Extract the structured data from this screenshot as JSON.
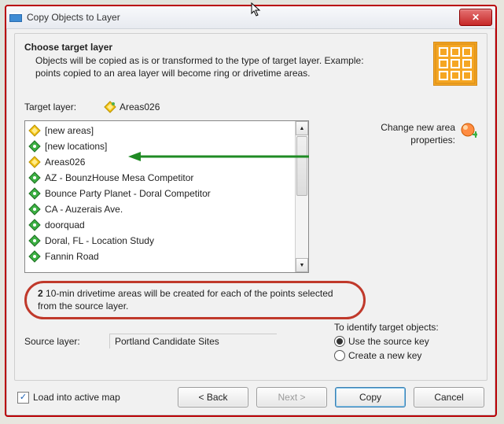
{
  "window": {
    "title": "Copy Objects to Layer",
    "close_label": "✕"
  },
  "header": {
    "heading": "Choose target layer",
    "subtext": "Objects will be copied as is or transformed to the type of target layer. Example: points copied to an area layer will become ring or drivetime areas."
  },
  "target": {
    "label": "Target layer:",
    "value": "Areas026",
    "icon": "layer-areas-icon"
  },
  "list": {
    "items": [
      {
        "label": "[new areas]",
        "icon": "layer-areas-icon"
      },
      {
        "label": "[new locations]",
        "icon": "layer-locations-icon"
      },
      {
        "label": "Areas026",
        "icon": "layer-areas-icon"
      },
      {
        "label": "AZ - BounzHouse Mesa Competitor",
        "icon": "layer-locations-icon"
      },
      {
        "label": "Bounce Party Planet - Doral Competitor",
        "icon": "layer-locations-icon"
      },
      {
        "label": "CA - Auzerais Ave.",
        "icon": "layer-locations-icon"
      },
      {
        "label": "doorquad",
        "icon": "layer-locations-icon"
      },
      {
        "label": "Doral, FL - Location Study",
        "icon": "layer-locations-icon"
      },
      {
        "label": "Fannin Road",
        "icon": "layer-locations-icon"
      }
    ]
  },
  "change_area": {
    "line1": "Change new area",
    "line2": "properties:",
    "icon": "orange-ball-icon"
  },
  "callout": {
    "prefix": "2",
    "rest": " 10-min drivetime areas will be created for each of the points selected from the source layer."
  },
  "identify": {
    "heading": "To identify target objects:",
    "opt1": "Use the source key",
    "opt2": "Create a new key",
    "selected": 0
  },
  "source": {
    "label": "Source layer:",
    "value": "Portland Candidate Sites"
  },
  "footer": {
    "load_label": "Load into active map",
    "load_checked": true,
    "back": "< Back",
    "next": "Next >",
    "copy": "Copy",
    "cancel": "Cancel"
  },
  "icons": {
    "diamond_yellow": "#f5c518",
    "diamond_green": "#2e8b57",
    "accent_orange": "#f5a623",
    "green_arrow": "#1f8b24",
    "red_callout": "#c0392b"
  }
}
